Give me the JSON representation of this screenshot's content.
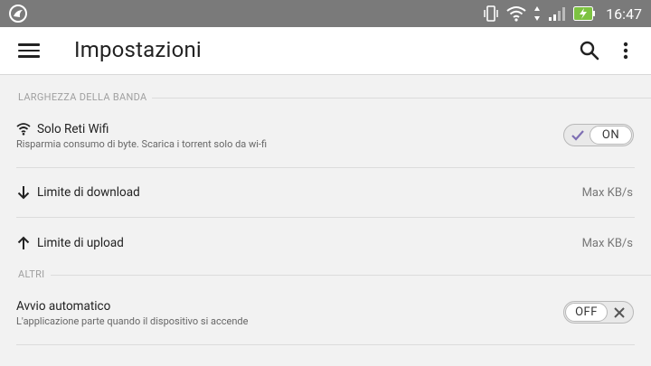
{
  "status_bar": {
    "time": "16:47",
    "icons": [
      "app-notification-icon",
      "vibrate-icon",
      "wifi-icon",
      "data-transfer-icon",
      "signal-icon",
      "battery-charging-icon"
    ]
  },
  "app_bar": {
    "title": "Impostazioni",
    "menu_icon": "menu-icon",
    "search_icon": "search-icon",
    "more_icon": "more-vert-icon"
  },
  "sections": [
    {
      "header": "LARGHEZZA DELLA BANDA",
      "items": [
        {
          "title": "Solo Reti Wifi",
          "subtitle": "Risparmia consumo di byte. Scarica i torrent solo da wi-fi",
          "icon": "wifi-icon",
          "toggle": "ON"
        },
        {
          "title": "Limite di download",
          "icon": "arrow-down-icon",
          "value": "Max KB/s"
        },
        {
          "title": "Limite di upload",
          "icon": "arrow-up-icon",
          "value": "Max KB/s"
        }
      ]
    },
    {
      "header": "ALTRI",
      "items": [
        {
          "title": "Avvio automatico",
          "subtitle": "L'applicazione parte quando il dispositivo si accende",
          "toggle": "OFF"
        }
      ]
    }
  ],
  "colors": {
    "status_bar": "#7a7a7a",
    "battery": "#7dc242",
    "toggle_check": "#7e6fb3",
    "background": "#f2f2f2"
  }
}
